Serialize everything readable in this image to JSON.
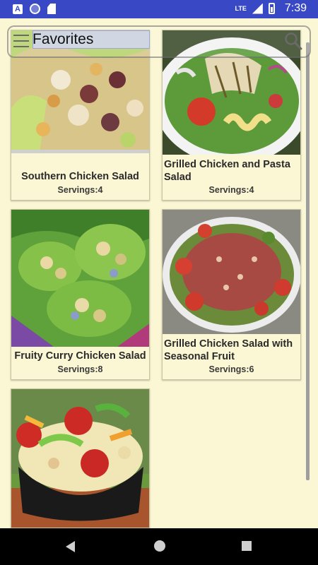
{
  "status_bar": {
    "time": "7:39",
    "network": "LTE",
    "notification_icons": [
      "a-app-icon",
      "circle-icon",
      "sd-card-icon"
    ]
  },
  "app_bar": {
    "title": "Favorites",
    "menu_icon": "hamburger-menu-icon",
    "search_icon": "search-icon"
  },
  "recipes": [
    {
      "title": "Southern Chicken Salad",
      "servings": "Servings:4",
      "image": "chicken-salad-lettuce-image"
    },
    {
      "title": "Grilled Chicken and Pasta Salad",
      "servings": "Servings:4",
      "image": "grilled-chicken-pasta-image"
    },
    {
      "title": "Fruity Curry Chicken Salad",
      "servings": "Servings:8",
      "image": "curry-chicken-lettuce-cups-image"
    },
    {
      "title": "Grilled Chicken Salad with Seasonal Fruit",
      "servings": "Servings:6",
      "image": "seasonal-fruit-salad-plate-image"
    },
    {
      "title": "",
      "servings": "",
      "image": "tortellini-salad-bowl-image"
    }
  ],
  "nav_bar": {
    "buttons": [
      "back-icon",
      "home-icon",
      "recent-apps-icon"
    ]
  }
}
